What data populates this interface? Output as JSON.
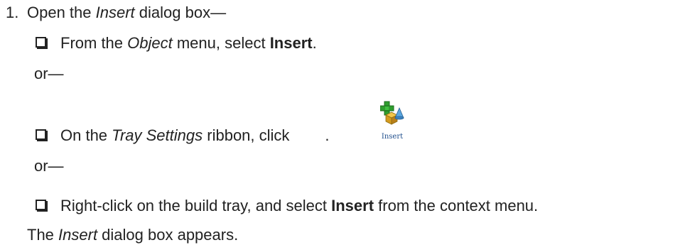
{
  "step_number": "1.",
  "step_title_pre": "Open the ",
  "step_title_em": "Insert",
  "step_title_post": " dialog box—",
  "option1": {
    "pre": "From the ",
    "em": "Object",
    "mid": " menu, select ",
    "bold": "Insert",
    "post": "."
  },
  "or_1": "or—",
  "option2": {
    "pre": "On the ",
    "em": "Tray Settings",
    "mid": " ribbon, click",
    "post": ".",
    "icon": "insert-ribbon-icon",
    "icon_caption": "Insert"
  },
  "or_2": "or—",
  "option3": {
    "pre": "Right-click on the build tray, and select ",
    "bold": "Insert",
    "post": " from the context menu."
  },
  "result": {
    "pre": "The ",
    "em": "Insert",
    "post": " dialog box appears."
  }
}
